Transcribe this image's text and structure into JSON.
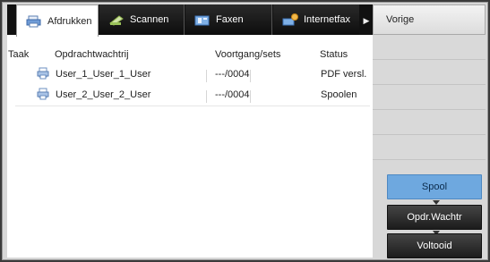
{
  "tabs": [
    {
      "label": "Afdrukken",
      "icon": "printer-icon",
      "active": true
    },
    {
      "label": "Scannen",
      "icon": "scanner-icon",
      "active": false
    },
    {
      "label": "Faxen",
      "icon": "fax-icon",
      "active": false
    },
    {
      "label": "Internetfax",
      "icon": "internet-fax-icon",
      "active": false
    }
  ],
  "sidebar": {
    "back_label": "Vorige",
    "buttons": [
      {
        "label": "Spool",
        "selected": true
      },
      {
        "label": "Opdr.Wachtr",
        "selected": false
      },
      {
        "label": "Voltooid",
        "selected": false
      }
    ]
  },
  "table": {
    "headers": {
      "job": "Taak",
      "queue": "Opdrachtwachtrij",
      "progress": "Voortgang/sets",
      "status": "Status"
    },
    "rows": [
      {
        "queue": "User_1_User_1_User",
        "progress": "---/0004",
        "status": "PDF versl."
      },
      {
        "queue": "User_2_User_2_User",
        "progress": "---/0004",
        "status": "Spoolen"
      }
    ]
  },
  "colors": {
    "accent_selected": "#6ea8df",
    "tab_background": "#111111",
    "sidebar_background": "#d8d8d8"
  }
}
